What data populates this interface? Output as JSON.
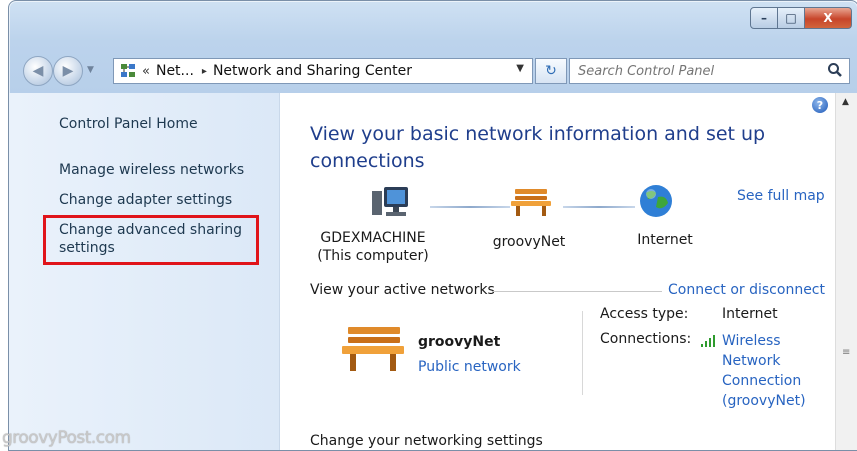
{
  "window": {
    "buttons": {
      "minimize": "–",
      "maximize": "□",
      "close": "X"
    }
  },
  "nav": {
    "back_icon": "back-arrow-icon",
    "forward_icon": "forward-arrow-icon",
    "address": {
      "chevrons": "«",
      "crumbs": [
        "Net...",
        "Network and Sharing Center"
      ],
      "separator": "▸"
    },
    "search_placeholder": "Search Control Panel"
  },
  "sidebar": {
    "home": "Control Panel Home",
    "links": [
      "Manage wireless networks",
      "Change adapter settings",
      "Change advanced sharing settings"
    ]
  },
  "main": {
    "heading": "View your basic network information and set up connections",
    "see_full_map": "See full map",
    "map_nodes": [
      {
        "name": "GDEXMACHINE",
        "sub": "(This computer)"
      },
      {
        "name": "groovyNet"
      },
      {
        "name": "Internet"
      }
    ],
    "active_networks_label": "View your active networks",
    "connect_or_disconnect": "Connect or disconnect",
    "network": {
      "name": "groovyNet",
      "type": "Public network",
      "access_type_label": "Access type:",
      "access_type_value": "Internet",
      "connections_label": "Connections:",
      "connection_lines": [
        "Wireless",
        "Network",
        "Connection",
        "(groovyNet)"
      ]
    },
    "change_settings": "Change your networking settings"
  },
  "watermark": "groovyPost.com",
  "colors": {
    "link": "#2864c1",
    "heading": "#1f3e8c",
    "highlight": "#e0141a",
    "close": "#c7452a"
  }
}
